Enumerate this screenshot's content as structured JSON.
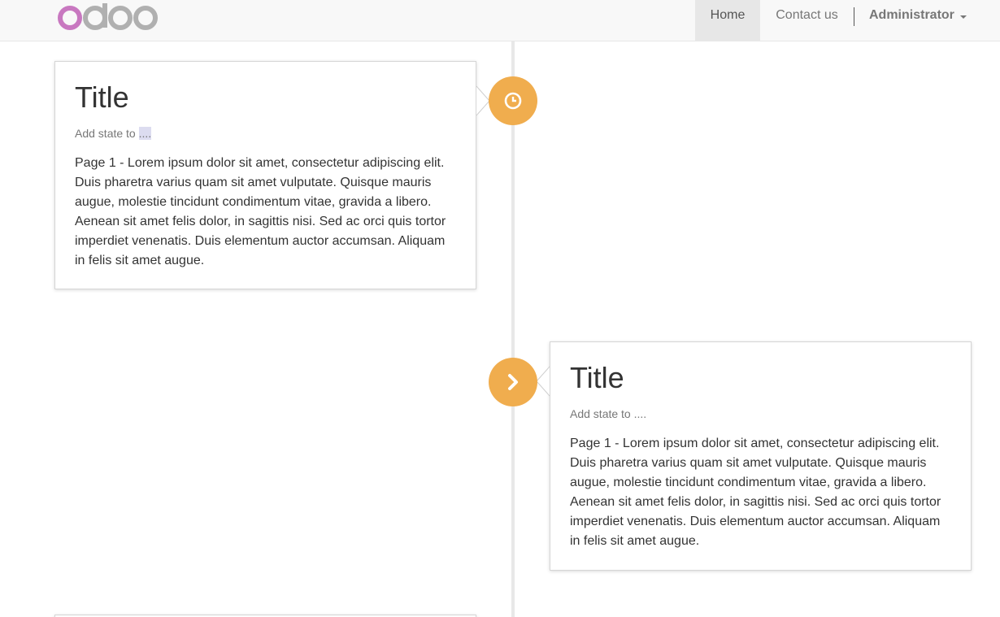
{
  "navbar": {
    "brand": "odoo",
    "home": "Home",
    "contact": "Contact us",
    "user": "Administrator"
  },
  "colors": {
    "badge": "#f0ad4e",
    "logo_o": "#c878c0",
    "logo_doo": "#b0b0b0"
  },
  "timeline": [
    {
      "icon": "clock-icon",
      "title": "Title",
      "state_prefix": "Add state to ",
      "state_link": "....",
      "body": "Page 1 - Lorem ipsum dolor sit amet, consectetur adipiscing elit. Duis pharetra varius quam sit amet vulputate. Quisque mauris augue, molestie tincidunt condimentum vitae, gravida a libero. Aenean sit amet felis dolor, in sagittis nisi. Sed ac orci quis tortor imperdiet venenatis. Duis elementum auctor accumsan. Aliquam in felis sit amet augue."
    },
    {
      "icon": "chevron-right-icon",
      "title": "Title",
      "state_prefix": "Add state to ",
      "state_link": "....",
      "body": "Page 1 - Lorem ipsum dolor sit amet, consectetur adipiscing elit. Duis pharetra varius quam sit amet vulputate. Quisque mauris augue, molestie tincidunt condimentum vitae, gravida a libero. Aenean sit amet felis dolor, in sagittis nisi. Sed ac orci quis tortor imperdiet venenatis. Duis elementum auctor accumsan. Aliquam in felis sit amet augue."
    }
  ]
}
